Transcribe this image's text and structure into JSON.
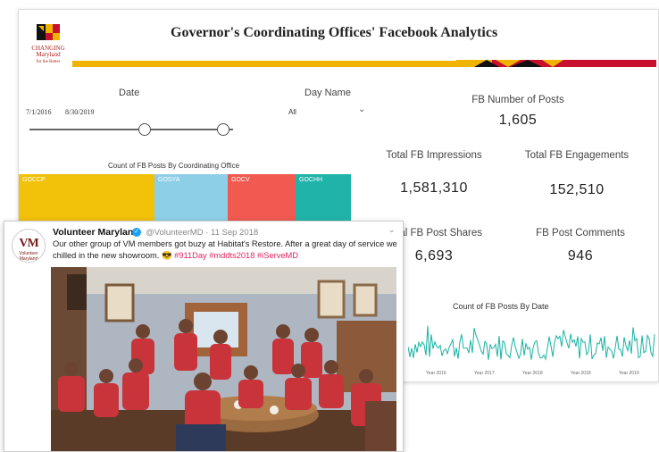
{
  "dashboard": {
    "title": "Governor's Coordinating Offices' Facebook Analytics",
    "logo": {
      "word1": "CHANGING",
      "word2": "Maryland",
      "word3": "for the Better"
    },
    "filters": {
      "date_label": "Date",
      "date_start": "7/1/2016",
      "date_end": "8/30/2019",
      "day_label": "Day Name",
      "day_value": "All"
    },
    "kpis": {
      "posts_label": "FB Number of Posts",
      "posts_value": "1,605",
      "impressions_label": "Total FB Impressions",
      "impressions_value": "1,581,310",
      "engagements_label": "Total FB Engagements",
      "engagements_value": "152,510",
      "shares_label": "Total FB Post Shares",
      "shares_value": "6,693",
      "comments_label": "FB Post Comments",
      "comments_value": "946"
    },
    "treemap": {
      "title": "Count of FB Posts By Coordinating Office",
      "cells": [
        {
          "label": "GOCCP",
          "color": "#f2c10a"
        },
        {
          "label": "GOSYA",
          "color": "#8ecfe8"
        },
        {
          "label": "GOCV",
          "color": "#f05a50"
        },
        {
          "label": "GOCHH",
          "color": "#20b3aa"
        }
      ]
    },
    "date_chart": {
      "title": "Count of FB Posts By Date",
      "x_ticks": [
        "Year 2016",
        "Year 2017",
        "Year 2018",
        "Year 2018",
        "Year 2019"
      ],
      "color": "#18b3a3"
    }
  },
  "tweet": {
    "avatar_text": "VM",
    "avatar_sub": "Volunteer Maryland",
    "name": "Volunteer Maryland",
    "handle_date": "@VolunteerMD · 11 Sep 2018",
    "caret": "⌄",
    "text": "Our other group of VM members got buzy at Habitat's Restore. After a great day of service we chilled in the new showroom. 😎 ",
    "hashtags": "#911Day #mddts2018 #iServeMD",
    "tag_color": "#e0245e"
  }
}
